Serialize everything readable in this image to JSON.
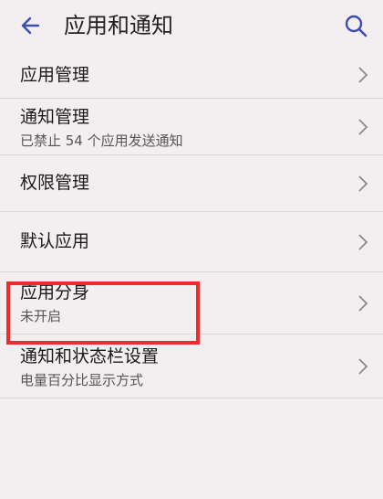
{
  "header": {
    "title": "应用和通知",
    "back_icon": "arrow-left-icon",
    "search_icon": "search-icon"
  },
  "items": [
    {
      "label": "应用管理"
    },
    {
      "label": "通知管理",
      "sub": "已禁止 54 个应用发送通知"
    },
    {
      "label": "权限管理"
    },
    {
      "label": "默认应用"
    },
    {
      "label": "应用分身",
      "sub": "未开启"
    },
    {
      "label": "通知和状态栏设置",
      "sub": "电量百分比显示方式"
    }
  ],
  "colors": {
    "background": "#f3eef0",
    "accent_icon": "#3f4fae",
    "highlight_border": "#ee2c2c"
  }
}
